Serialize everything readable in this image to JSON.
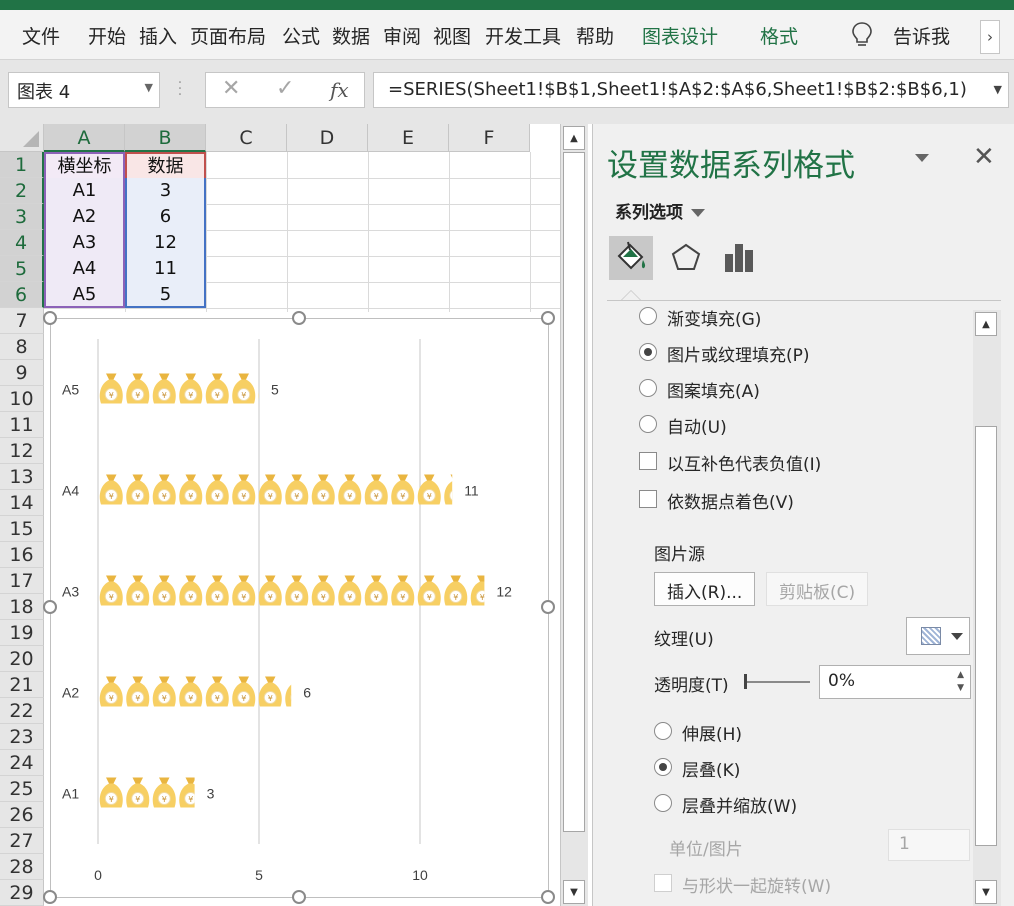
{
  "ribbon": {
    "tabs": [
      "文件",
      "开始",
      "插入",
      "页面布局",
      "公式",
      "数据",
      "审阅",
      "视图",
      "开发工具",
      "帮助",
      "图表设计",
      "格式"
    ],
    "tell_me": "告诉我",
    "more": "›"
  },
  "formula_bar": {
    "name_box": "图表 4",
    "cancel": "✕",
    "enter": "✓",
    "fx": "fx",
    "formula": "=SERIES(Sheet1!$B$1,Sheet1!$A$2:$A$6,Sheet1!$B$2:$B$6,1)"
  },
  "sheet": {
    "columns": [
      "A",
      "B",
      "C",
      "D",
      "E",
      "F"
    ],
    "rows": [
      "1",
      "2",
      "3",
      "4",
      "5",
      "6",
      "7",
      "8",
      "9",
      "10",
      "11",
      "12",
      "13",
      "14",
      "15",
      "16",
      "17",
      "18",
      "19",
      "20",
      "21",
      "22",
      "23",
      "24",
      "25",
      "26",
      "27",
      "28",
      "29"
    ],
    "header_a": "横坐标",
    "header_b": "数据",
    "data": [
      {
        "a": "A1",
        "b": "3"
      },
      {
        "a": "A2",
        "b": "6"
      },
      {
        "a": "A3",
        "b": "12"
      },
      {
        "a": "A4",
        "b": "11"
      },
      {
        "a": "A5",
        "b": "5"
      }
    ]
  },
  "chart_data": {
    "type": "bar",
    "orientation": "horizontal",
    "categories": [
      "A1",
      "A2",
      "A3",
      "A4",
      "A5"
    ],
    "values": [
      3,
      6,
      12,
      11,
      5
    ],
    "x_ticks": [
      "0",
      "5",
      "10"
    ],
    "xlim": [
      0,
      15
    ],
    "grid": "vertical",
    "data_labels": [
      "3",
      "6",
      "12",
      "11",
      "5"
    ],
    "fill": "stacked picture (money bag)",
    "picture_glyph": "¥",
    "colors": {
      "bag": "#f7cf63",
      "bag_dark": "#e9b540",
      "coin": "#ffffff",
      "coin_text": "#c9953a",
      "grid": "#d0d0d0",
      "label": "#404040"
    }
  },
  "pane": {
    "title": "设置数据系列格式",
    "section": "系列选项",
    "fill_options": [
      {
        "label": "渐变填充(G)",
        "selected": false
      },
      {
        "label": "图片或纹理填充(P)",
        "selected": true
      },
      {
        "label": "图案填充(A)",
        "selected": false
      },
      {
        "label": "自动(U)",
        "selected": false
      }
    ],
    "checks": [
      "以互补色代表负值(I)",
      "依数据点着色(V)"
    ],
    "picture_source": "图片源",
    "insert_button": "插入(R)...",
    "clipboard_button": "剪贴板(C)",
    "texture_label": "纹理(U)",
    "transparency_label": "透明度(T)",
    "transparency_value": "0%",
    "placement": [
      {
        "label": "伸展(H)",
        "selected": false
      },
      {
        "label": "层叠(K)",
        "selected": true
      },
      {
        "label": "层叠并缩放(W)",
        "selected": false
      }
    ],
    "units_label": "单位/图片",
    "units_value": "1",
    "rotate_label": "与形状一起旋转(W)",
    "close": "✕"
  }
}
